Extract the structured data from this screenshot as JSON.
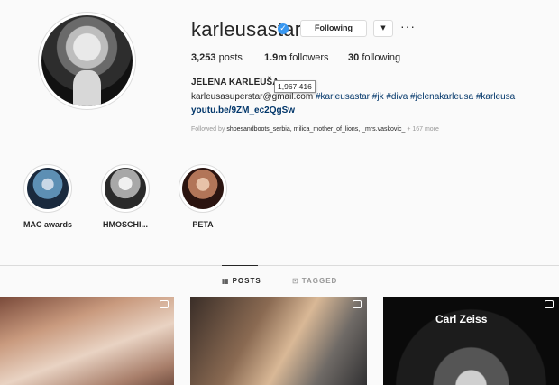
{
  "profile": {
    "username": "karleusastar",
    "following_btn": "Following",
    "dropdown_icon": "chevron-down-icon",
    "more_icon": "more-dots-icon",
    "posts_count": "3,253",
    "posts_label": "posts",
    "followers_count": "1.9m",
    "followers_label": "followers",
    "following_count": "30",
    "following_label": "following",
    "full_name": "JELENA KARLEUŠA",
    "tooltip": "1,967,416",
    "bio_email": "karleusasuperstar@gmail.com",
    "bio_tags": "#karleusastar #jk #diva #jelenakarleusa #karleusa",
    "link": "youtu.be/9ZM_ec2QgSw",
    "followed_prefix": "Followed by",
    "followed_names": "shoesandboots_serbia, milica_mother_of_lions, _mrs.vaskovic_",
    "followed_more": "+ 167 more"
  },
  "highlights": [
    {
      "label": "MAC awards",
      "color": "#3a6d8f"
    },
    {
      "label": "HMOSCHI...",
      "color": "#8a8a8a"
    },
    {
      "label": "PETA",
      "color": "#6b3b2a"
    }
  ],
  "tabs": {
    "posts": "POSTS",
    "tagged": "TAGGED"
  },
  "posts": [
    {
      "caption": ""
    },
    {
      "caption": ""
    },
    {
      "caption": "Carl Zeiss"
    }
  ],
  "colors": {
    "link": "#003569",
    "verified": "#3897f0"
  }
}
